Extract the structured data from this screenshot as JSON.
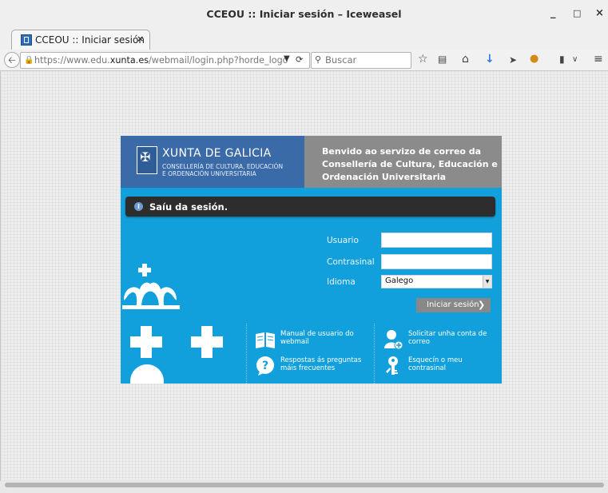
{
  "window": {
    "title": "CCEOU :: Iniciar sesión – Iceweasel",
    "minimize": "_",
    "maximize": "□",
    "close": "×"
  },
  "tab": {
    "label": "CCEOU :: Iniciar sesión",
    "close": "×",
    "new_tab": "✚"
  },
  "navbar": {
    "url_prefix": "https://www.edu.",
    "url_domain": "xunta.es",
    "url_path": "/webmail/login.php?horde_logo",
    "search_placeholder": "Buscar"
  },
  "header": {
    "org_name": "XUNTA DE GALICIA",
    "org_sub_1": "CONSELLERÍA DE CULTURA, EDUCACIÓN",
    "org_sub_2": "E ORDENACIÓN UNIVERSITARIA",
    "welcome": "Benvido ao servizo de correo da Consellería de Cultura, Educación e Ordenación Universitaria"
  },
  "notice": {
    "message": "Saíu da sesión."
  },
  "form": {
    "username_label": "Usuario",
    "password_label": "Contrasinal",
    "language_label": "Idioma",
    "language_value": "Galego",
    "submit_label": "Iniciar sesión"
  },
  "links": {
    "manual": "Manual de usuario do webmail",
    "faq": "Respostas ás preguntas máis frecuentes",
    "request_account": "Solicitar unha conta de correo",
    "forgot_password": "Esquecín o meu contrasinal"
  },
  "colors": {
    "login_bg": "#12a0dc",
    "header_blue": "#3a6aa8",
    "header_gray": "#8b8b8b",
    "notice_bg": "#2d2d2d"
  }
}
